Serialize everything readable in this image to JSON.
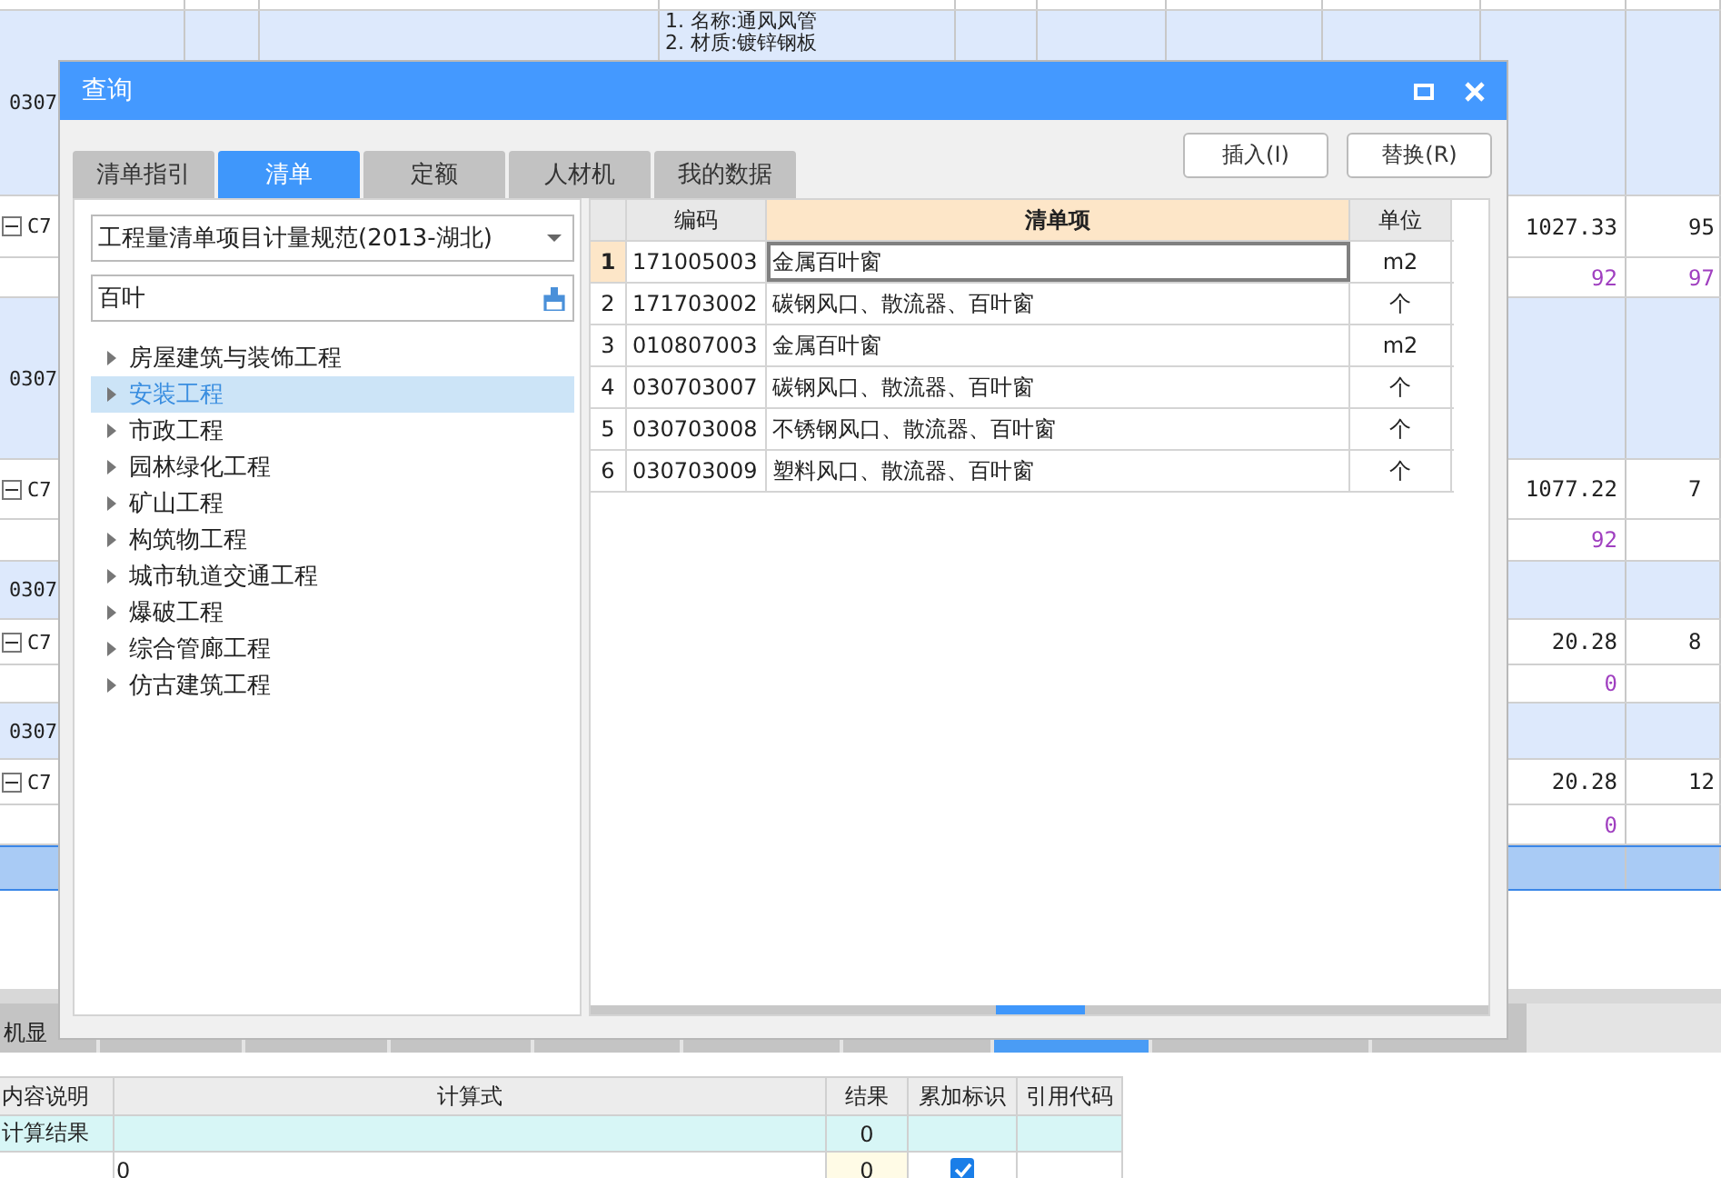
{
  "background": {
    "description": [
      "1. 名称:通风风管",
      "2. 材质:镀锌钢板"
    ],
    "rows": [
      {
        "kind": "group",
        "code": "0307"
      },
      {
        "kind": "item",
        "code": "C7",
        "col_8": "1027.33",
        "col_9": "95"
      },
      {
        "kind": "sub",
        "col_8": "92",
        "col_9": "97"
      },
      {
        "kind": "group",
        "code": "0307"
      },
      {
        "kind": "item",
        "code": "C7",
        "col_8": "1077.22",
        "col_9": "7"
      },
      {
        "kind": "sub",
        "col_8": "92"
      },
      {
        "kind": "group",
        "code": "0307"
      },
      {
        "kind": "item",
        "code": "C7",
        "col_8": "20.28",
        "col_9": "8"
      },
      {
        "kind": "sub",
        "col_8": "0"
      },
      {
        "kind": "group",
        "code": "0307"
      },
      {
        "kind": "item",
        "code": "C7",
        "col_8": "20.28",
        "col_9": "12"
      },
      {
        "kind": "sub",
        "col_8": "0"
      },
      {
        "kind": "selected"
      }
    ],
    "tabs": [
      {
        "label": "机显",
        "selected": false
      },
      {
        "selected": false
      },
      {
        "selected": false
      },
      {
        "selected": false
      },
      {
        "selected": false
      },
      {
        "selected": false
      },
      {
        "selected": false
      },
      {
        "selected": true
      },
      {
        "selected": false
      },
      {
        "selected": false
      }
    ]
  },
  "dialog": {
    "title": "查询",
    "tabs": [
      {
        "label": "清单指引",
        "selected": false
      },
      {
        "label": "清单",
        "selected": true
      },
      {
        "label": "定额",
        "selected": false
      },
      {
        "label": "人材机",
        "selected": false
      },
      {
        "label": "我的数据",
        "selected": false
      }
    ],
    "buttons": [
      "插入(I)",
      "替换(R)"
    ],
    "standard": "工程量清单项目计量规范(2013-湖北)",
    "search": "百叶",
    "tree": [
      {
        "label": "房屋建筑与装饰工程",
        "selected": false
      },
      {
        "label": "安装工程",
        "selected": true
      },
      {
        "label": "市政工程",
        "selected": false
      },
      {
        "label": "园林绿化工程",
        "selected": false
      },
      {
        "label": "矿山工程",
        "selected": false
      },
      {
        "label": "构筑物工程",
        "selected": false
      },
      {
        "label": "城市轨道交通工程",
        "selected": false
      },
      {
        "label": "爆破工程",
        "selected": false
      },
      {
        "label": "综合管廊工程",
        "selected": false
      },
      {
        "label": "仿古建筑工程",
        "selected": false
      }
    ],
    "table": {
      "columns": [
        "编码",
        "清单项",
        "单位"
      ],
      "rows": [
        {
          "index": "1",
          "code": "171005003",
          "name": "金属百叶窗",
          "unit": "m2",
          "selected": true
        },
        {
          "index": "2",
          "code": "171703002",
          "name": "碳钢风口、散流器、百叶窗",
          "unit": "个",
          "selected": false
        },
        {
          "index": "3",
          "code": "010807003",
          "name": "金属百叶窗",
          "unit": "m2",
          "selected": false
        },
        {
          "index": "4",
          "code": "030703007",
          "name": "碳钢风口、散流器、百叶窗",
          "unit": "个",
          "selected": false
        },
        {
          "index": "5",
          "code": "030703008",
          "name": "不锈钢风口、散流器、百叶窗",
          "unit": "个",
          "selected": false
        },
        {
          "index": "6",
          "code": "030703009",
          "name": "塑料风口、散流器、百叶窗",
          "unit": "个",
          "selected": false
        }
      ]
    }
  },
  "detail_table": {
    "columns": [
      "内容说明",
      "计算式",
      "结果",
      "累加标识",
      "引用代码"
    ],
    "rows": [
      {
        "kind": "total",
        "label": "计算结果",
        "formula": "",
        "result": "0",
        "checked": false
      },
      {
        "kind": "line",
        "label": "",
        "formula": "0",
        "result": "0",
        "checked": true
      }
    ]
  }
}
